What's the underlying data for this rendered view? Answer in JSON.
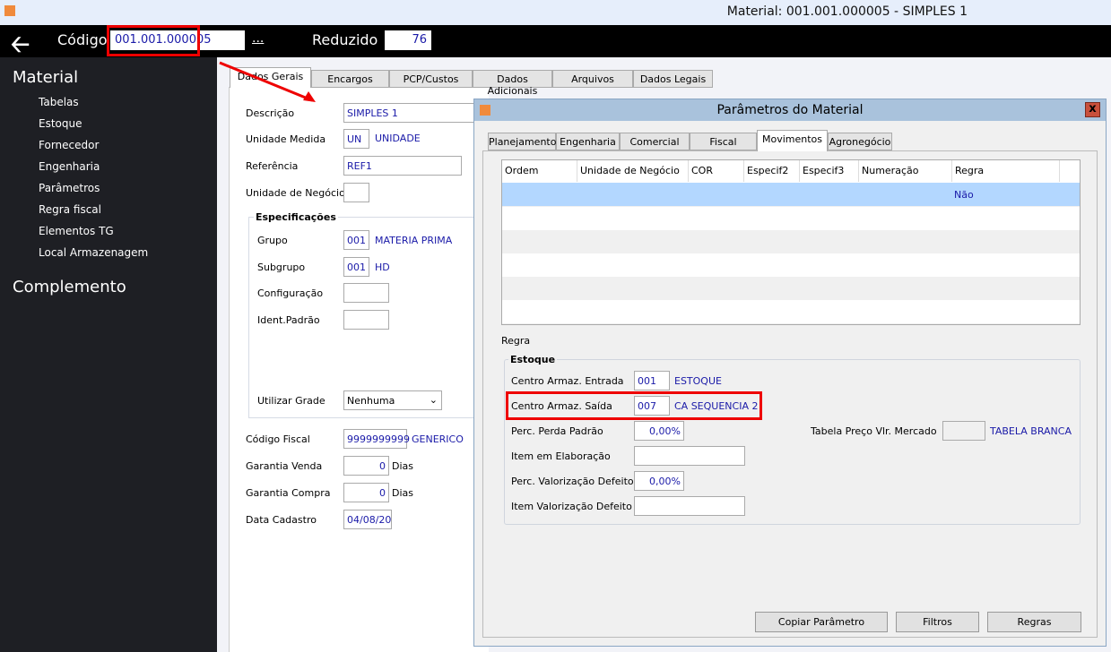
{
  "window": {
    "title": "Material: 001.001.000005 - SIMPLES 1"
  },
  "header": {
    "codigo_label": "Código",
    "codigo_value": "001.001.000005",
    "ellipsis": "...",
    "reduzido_label": "Reduzido",
    "reduzido_value": "76"
  },
  "sidebar": {
    "section1": "Material",
    "items": [
      "Tabelas",
      "Estoque",
      "Fornecedor",
      "Engenharia",
      "Parâmetros",
      "Regra fiscal",
      "Elementos TG",
      "Local Armazenagem"
    ],
    "section2": "Complemento"
  },
  "main": {
    "tabs": [
      "Dados Gerais",
      "Encargos",
      "PCP/Custos",
      "Dados Adicionais",
      "Arquivos",
      "Dados Legais"
    ],
    "descricao_label": "Descrição",
    "descricao_value": "SIMPLES 1",
    "unidade_label": "Unidade Medida",
    "unidade_value": "UN",
    "unidade_desc": "UNIDADE",
    "referencia_label": "Referência",
    "referencia_value": "REF1",
    "unidade_negocio_label": "Unidade de Negócio",
    "especificacoes_title": "Especificações",
    "grupo_label": "Grupo",
    "grupo_value": "001",
    "grupo_desc": "MATERIA PRIMA",
    "subgrupo_label": "Subgrupo",
    "subgrupo_value": "001",
    "subgrupo_desc": "HD",
    "configuracao_label": "Configuração",
    "ident_label": "Ident.Padrão",
    "grade_label": "Utilizar Grade",
    "grade_value": "Nenhuma",
    "fiscal_label": "Código Fiscal",
    "fiscal_value": "9999999999",
    "fiscal_desc": "GENERICO",
    "garantia_venda_label": "Garantia Venda",
    "garantia_venda_value": "0",
    "garantia_compra_label": "Garantia Compra",
    "garantia_compra_value": "0",
    "dias": "Dias",
    "data_label": "Data Cadastro",
    "data_value": "04/08/20"
  },
  "dialog": {
    "title": "Parâmetros do Material",
    "close": "x",
    "tabs": [
      "Planejamento",
      "Engenharia",
      "Comercial",
      "Fiscal",
      "Movimentos",
      "Agronegócio"
    ],
    "columns": [
      "Ordem",
      "Unidade de Negócio",
      "COR",
      "Especif2",
      "Especif3",
      "Numeração",
      "Regra"
    ],
    "row": {
      "regra": "Não"
    },
    "regra_label": "Regra",
    "estoque_title": "Estoque",
    "entrada_label": "Centro Armaz. Entrada",
    "entrada_value": "001",
    "entrada_desc": "ESTOQUE",
    "saida_label": "Centro Armaz. Saída",
    "saida_value": "007",
    "saida_desc": "CA SEQUENCIA 2",
    "perda_label": "Perc. Perda Padrão",
    "perda_value": "0,00%",
    "elaboracao_label": "Item em Elaboração",
    "valorizacao_label": "Perc. Valorização Defeito",
    "valorizacao_value": "0,00%",
    "item_valorizacao_label": "Item Valorização Defeito",
    "tabela_label": "Tabela Preço Vlr. Mercado",
    "tabela_desc": "TABELA BRANCA",
    "buttons": [
      "Copiar Parâmetro",
      "Filtros",
      "Regras"
    ]
  }
}
